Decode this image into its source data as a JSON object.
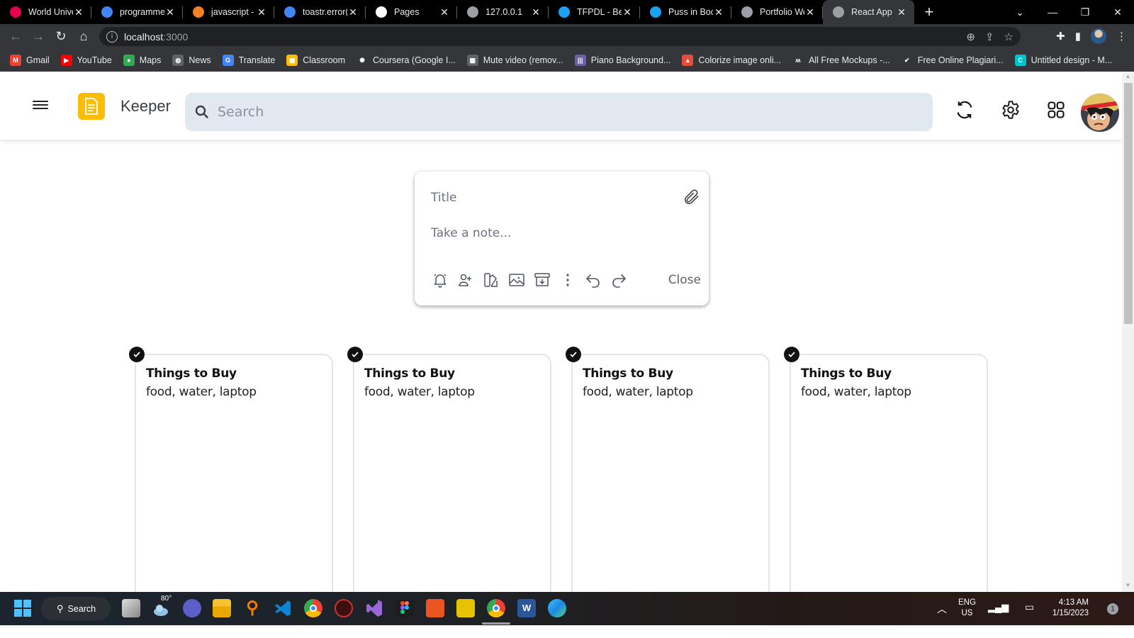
{
  "browser": {
    "tabs": [
      {
        "title": "World Univer",
        "icon": "the-logo-icon",
        "color": "#e7004c"
      },
      {
        "title": "programme",
        "icon": "google-icon",
        "color": "#4285f4"
      },
      {
        "title": "javascript - H",
        "icon": "stackoverflow-icon",
        "color": "#f48024"
      },
      {
        "title": "toastr.error(",
        "icon": "google-icon",
        "color": "#4285f4"
      },
      {
        "title": "Pages",
        "icon": "github-icon",
        "color": "#ffffff"
      },
      {
        "title": "127.0.0.1",
        "icon": "globe-icon",
        "color": "#9aa0a6"
      },
      {
        "title": "TFPDL - Best",
        "icon": "t-logo-icon",
        "color": "#1da1f2"
      },
      {
        "title": "Puss in Boots",
        "icon": "t-logo-icon",
        "color": "#1da1f2"
      },
      {
        "title": "Portfolio We",
        "icon": "globe-icon",
        "color": "#9aa0a6"
      },
      {
        "title": "React App",
        "icon": "globe-icon",
        "color": "#9aa0a6",
        "active": true
      }
    ],
    "new_tab": "+",
    "window_controls": {
      "tab_search": "⌄",
      "minimize": "—",
      "restore": "❐",
      "close": "✕"
    },
    "url_host": "localhost",
    "url_port": ":3000",
    "bookmarks": [
      {
        "label": "Gmail",
        "icon": "gmail-icon",
        "color": "#ea4335",
        "glyph": "M"
      },
      {
        "label": "YouTube",
        "icon": "youtube-icon",
        "color": "#ff0000",
        "glyph": "▶"
      },
      {
        "label": "Maps",
        "icon": "maps-icon",
        "color": "#34a853",
        "glyph": "●"
      },
      {
        "label": "News",
        "icon": "globe-icon",
        "color": "#5f6368",
        "glyph": "◍"
      },
      {
        "label": "Translate",
        "icon": "translate-icon",
        "color": "#4285f4",
        "glyph": "G"
      },
      {
        "label": "Classroom",
        "icon": "classroom-icon",
        "color": "#fbbc04",
        "glyph": "▣"
      },
      {
        "label": "Coursera (Google I...",
        "icon": "coursera-icon",
        "color": "#35363a",
        "glyph": "✺"
      },
      {
        "label": "Mute video (remov...",
        "icon": "video-icon",
        "color": "#5f6368",
        "glyph": "▦"
      },
      {
        "label": "Piano Background...",
        "icon": "audio-icon",
        "color": "#6b5fa8",
        "glyph": "|||"
      },
      {
        "label": "Colorize image onli...",
        "icon": "tree-icon",
        "color": "#e74c3c",
        "glyph": "▲"
      },
      {
        "label": "All Free Mockups -...",
        "icon": "mockups-icon",
        "color": "#35363a",
        "glyph": "ʍ"
      },
      {
        "label": "Free Online Plagiari...",
        "icon": "plagiarism-icon",
        "color": "#35363a",
        "glyph": "✔"
      },
      {
        "label": "Untitled design - M...",
        "icon": "canva-icon",
        "color": "#00c4cc",
        "glyph": "C"
      }
    ]
  },
  "app": {
    "name": "Keeper",
    "search_placeholder": "Search",
    "accent": "#fbbc04",
    "create_note": {
      "title_placeholder": "Title",
      "body_placeholder": "Take a note...",
      "close_label": "Close",
      "tools": [
        "bell-icon",
        "add-collaborator-icon",
        "palette-icon",
        "image-icon",
        "archive-icon",
        "more-icon",
        "undo-icon",
        "redo-icon"
      ]
    },
    "notes": [
      {
        "title": "Things to Buy",
        "content": "food, water, laptop"
      },
      {
        "title": "Things to Buy",
        "content": "food, water, laptop"
      },
      {
        "title": "Things to Buy",
        "content": "food, water, laptop"
      },
      {
        "title": "Things to Buy",
        "content": "food, water, laptop"
      }
    ]
  },
  "taskbar": {
    "search_label": "Search",
    "weather": "80°",
    "lang_top": "ENG",
    "lang_bottom": "US",
    "time": "4:13 AM",
    "date": "1/15/2023",
    "notification_count": "1"
  }
}
